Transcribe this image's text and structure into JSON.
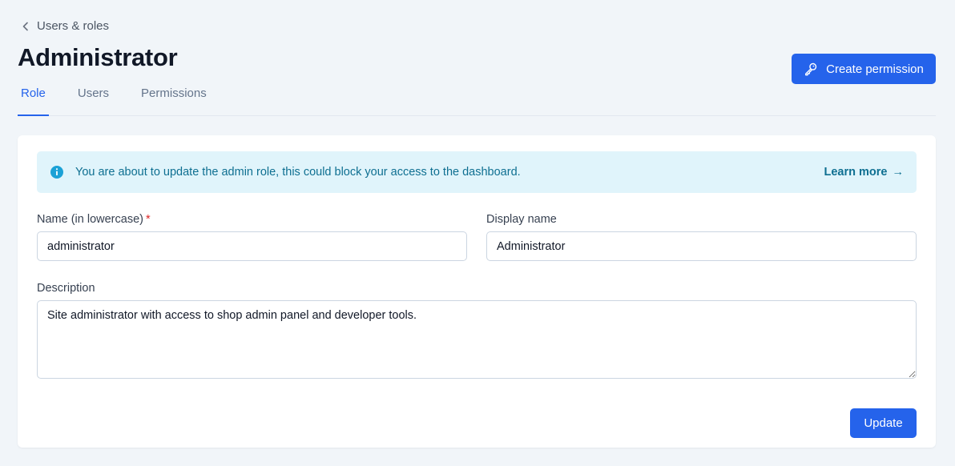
{
  "breadcrumb": {
    "label": "Users & roles"
  },
  "page": {
    "title": "Administrator"
  },
  "header": {
    "create_permission_label": "Create permission"
  },
  "tabs": [
    {
      "label": "Role",
      "active": true
    },
    {
      "label": "Users",
      "active": false
    },
    {
      "label": "Permissions",
      "active": false
    }
  ],
  "alert": {
    "message": "You are about to update the admin role, this could block your access to the dashboard.",
    "link_label": "Learn more",
    "link_arrow": "→"
  },
  "form": {
    "name": {
      "label": "Name (in lowercase)",
      "required_marker": "*",
      "value": "administrator"
    },
    "display_name": {
      "label": "Display name",
      "value": "Administrator"
    },
    "description": {
      "label": "Description",
      "value": "Site administrator with access to shop admin panel and developer tools."
    },
    "submit_label": "Update"
  },
  "colors": {
    "accent": "#2563eb",
    "alert_bg": "#e0f4fb",
    "alert_text": "#0e6f91",
    "background": "#f1f5f9"
  },
  "icons": {
    "breadcrumb": "chevron-left-icon",
    "create_permission": "key-icon",
    "alert": "info-icon"
  }
}
